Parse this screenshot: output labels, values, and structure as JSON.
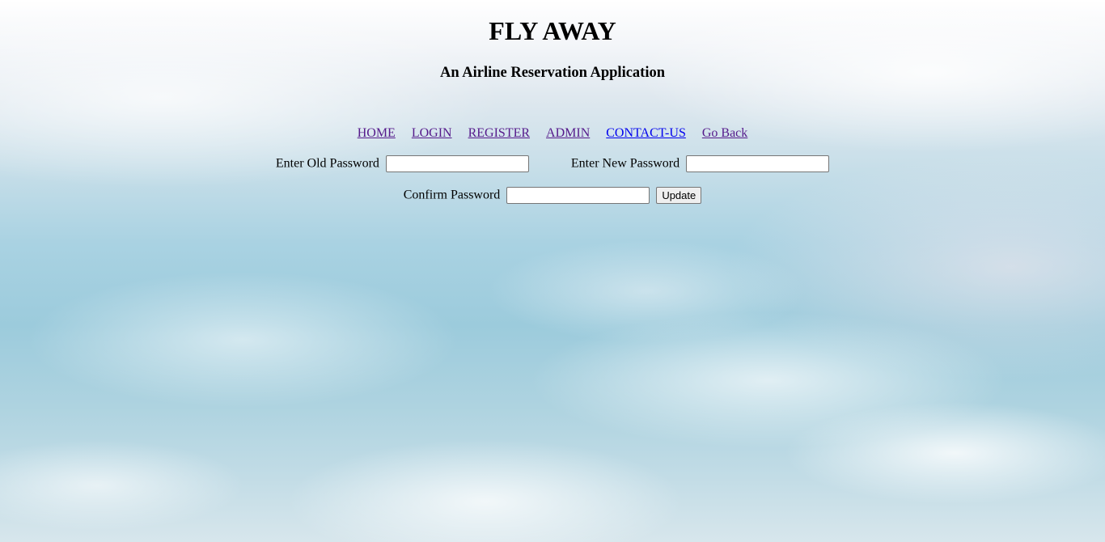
{
  "header": {
    "title": "FLY AWAY",
    "subtitle": "An Airline Reservation Application"
  },
  "nav": {
    "items": [
      {
        "label": "HOME",
        "state": "visited"
      },
      {
        "label": "LOGIN",
        "state": "visited"
      },
      {
        "label": "REGISTER",
        "state": "visited"
      },
      {
        "label": "ADMIN",
        "state": "visited"
      },
      {
        "label": "CONTACT-US",
        "state": "unvisited"
      },
      {
        "label": "Go Back",
        "state": "visited"
      }
    ]
  },
  "form": {
    "old_password_label": "Enter Old Password",
    "old_password_value": "",
    "new_password_label": "Enter New Password",
    "new_password_value": "",
    "confirm_password_label": "Confirm Password",
    "confirm_password_value": "",
    "submit_label": "Update"
  },
  "colors": {
    "link_visited": "#551a8b",
    "link_unvisited": "#0000ee",
    "text": "#000000"
  }
}
